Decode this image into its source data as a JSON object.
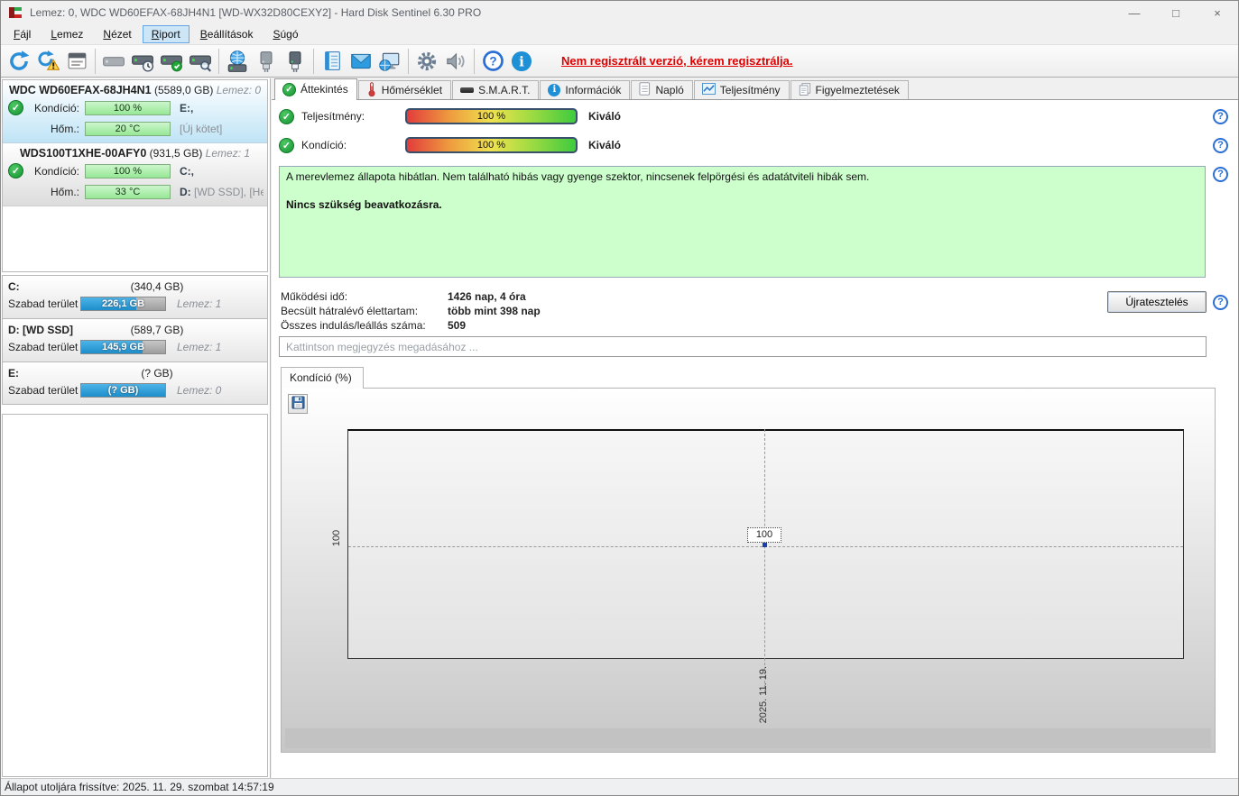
{
  "window": {
    "title": "Lemez: 0, WDC WD60EFAX-68JH4N1 [WD-WX32D80CEXY2]  -  Hard Disk Sentinel 6.30 PRO",
    "controls": {
      "minimize": "—",
      "maximize": "□",
      "close": "×"
    }
  },
  "menu": {
    "items": [
      "Fájl",
      "Lemez",
      "Nézet",
      "Riport",
      "Beállítások",
      "Súgó"
    ]
  },
  "toolbar": {
    "registration_notice": "Nem regisztrált verzió, kérem regisztrálja.",
    "icons": [
      "refresh",
      "refresh-warning",
      "report",
      "disk-offline",
      "disk-clock",
      "disk-check",
      "disk-search",
      "network-disk",
      "disk-plug",
      "disk-plug-blue",
      "notepad",
      "mail",
      "remote-monitor",
      "settings-gear",
      "sound",
      "help",
      "info"
    ]
  },
  "sidebar": {
    "disks": [
      {
        "name": "WDC WD60EFAX-68JH4N1",
        "size": "(5589,0 GB)",
        "disk": "Lemez: 0",
        "condition_label": "Kondíció:",
        "condition_value": "100 %",
        "temp_label": "Hőm.:",
        "temp_value": "20 °C",
        "vol_line1": "E:,",
        "vol_line2_strong": "",
        "vol_line2": "[Új kötet]"
      },
      {
        "name": "WDS100T1XHE-00AFY0",
        "size": "(931,5 GB)",
        "disk": "Lemez: 1",
        "condition_label": "Kondíció:",
        "condition_value": "100 %",
        "temp_label": "Hőm.:",
        "temp_value": "33 °C",
        "vol_line1": "C:,",
        "vol_line2_strong": "D:",
        "vol_line2": "[WD SSD],  [Helyr"
      }
    ],
    "partitions": [
      {
        "name": "C:",
        "size": "(340,4 GB)",
        "free_label": "Szabad terület",
        "free_value": "226,1 GB",
        "disk": "Lemez: 1",
        "fill": "66%"
      },
      {
        "name": "D: [WD SSD]",
        "size": "(589,7 GB)",
        "free_label": "Szabad terület",
        "free_value": "145,9 GB",
        "disk": "Lemez: 1",
        "fill": "73%"
      },
      {
        "name": "E:",
        "size": "(? GB)",
        "free_label": "Szabad terület",
        "free_value": "(? GB)",
        "disk": "Lemez: 0",
        "fill": "100%"
      }
    ]
  },
  "tabs": {
    "items": [
      "Áttekintés",
      "Hőmérséklet",
      "S.M.A.R.T.",
      "Információk",
      "Napló",
      "Teljesítmény",
      "Figyelmeztetések"
    ],
    "active": "Áttekintés"
  },
  "overview": {
    "performance_label": "Teljesítmény:",
    "performance_value": "100 %",
    "performance_rating": "Kiváló",
    "condition_label": "Kondíció:",
    "condition_value": "100 %",
    "condition_rating": "Kiváló",
    "status_line1": "A merevlemez állapota hibátlan. Nem található hibás vagy gyenge szektor, nincsenek felpörgési és adatátviteli hibák sem.",
    "status_line2": "Nincs szükség beavatkozásra.",
    "stats": [
      {
        "label": "Működési idő:",
        "value": "1426 nap, 4 óra"
      },
      {
        "label": "Becsült hátralévő élettartam:",
        "value": "több mint 398 nap"
      },
      {
        "label": "Összes indulás/leállás száma:",
        "value": "509"
      }
    ],
    "retest_button": "Újratesztelés",
    "comment_placeholder": "Kattintson megjegyzés megadásához ..."
  },
  "chart": {
    "tab_label": "Kondíció  (%)"
  },
  "chart_data": {
    "type": "line",
    "title": "Kondíció (%)",
    "x": [
      "2025. 11. 19."
    ],
    "series": [
      {
        "name": "Kondíció (%)",
        "values": [
          100
        ]
      }
    ],
    "yticks": [
      "100"
    ],
    "xticks": [
      "2025. 11. 19."
    ],
    "point_label": "100",
    "grid": "dashed-crosshair-at-point",
    "legend": "none"
  },
  "statusbar": {
    "text": "Állapot utoljára frissítve: 2025. 11. 29. szombat 14:57:19"
  },
  "colors": {
    "accent_blue": "#2b99d6",
    "status_green": "#1fa83c",
    "warning_red": "#e00000",
    "info_box_green": "#ccffcc",
    "bar_blue": "#1d8ecb"
  }
}
